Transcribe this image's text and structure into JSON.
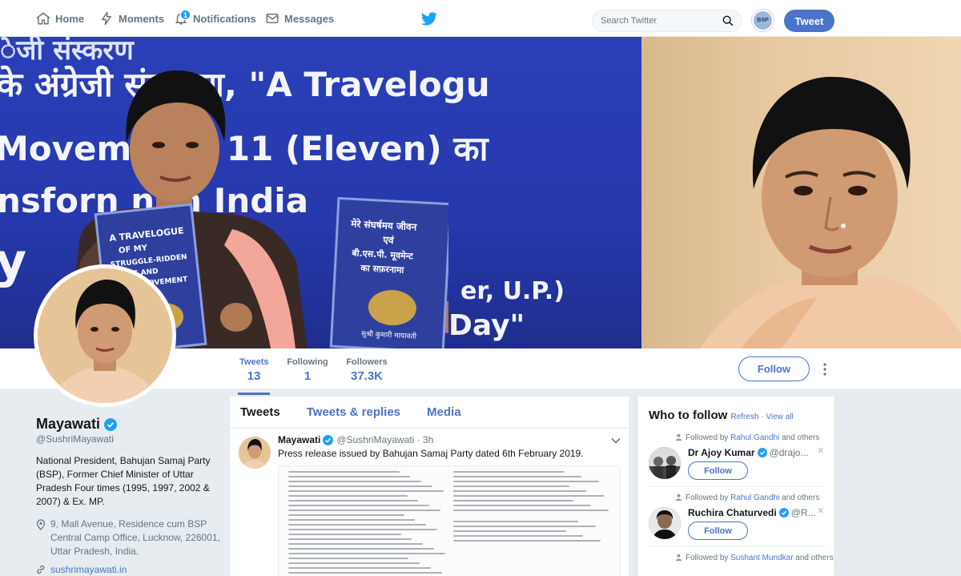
{
  "nav": {
    "home": "Home",
    "moments": "Moments",
    "notifications": "Notifications",
    "notification_count": "1",
    "messages": "Messages",
    "search_placeholder": "Search Twitter",
    "avatar_text": "BSP",
    "tweet_button": "Tweet"
  },
  "banner": {
    "line1": "ेजी संस्करण   ",
    "line2": "के अंग्रेजी संस्करण, \"A Travelogu",
    "line3": "Movem    Vol. 11 (Eleven) का",
    "line4": "nsforn    n in India",
    "line5": "y",
    "line6": "er, U.P.)",
    "line7": "Day\"",
    "book1_title": "A TRAVELOGUE OF MY STRUGGLE-RIDDEN LIFE AND B.S.P. MOVEMENT",
    "book2_title": "मेरे संघर्षमय जीवन एवं बी.एस.पी. मूवमेन्ट का सफ़रनामा",
    "book2_author": "सुश्री कुमारी मायावती"
  },
  "stats": [
    {
      "label": "Tweets",
      "value": "13"
    },
    {
      "label": "Following",
      "value": "1"
    },
    {
      "label": "Followers",
      "value": "37.3K"
    }
  ],
  "profile": {
    "follow_button": "Follow",
    "name": "Mayawati",
    "handle": "@SushriMayawati",
    "bio": "National President, Bahujan Samaj Party (BSP), Former Chief Minister of Uttar Pradesh Four times (1995, 1997, 2002 & 2007) & Ex. MP.",
    "location": "9, Mall Avenue, Residence cum BSP Central Camp Office, Lucknow, 226001, Uttar Pradesh, India.",
    "link": "sushrimayawati.in"
  },
  "timeline": {
    "tabs": [
      "Tweets",
      "Tweets & replies",
      "Media"
    ],
    "tweet": {
      "name": "Mayawati",
      "handle_time": "@SushriMayawati · 3h",
      "text": "Press release issued by Bahujan Samaj Party dated 6th February 2019."
    }
  },
  "who_to_follow": {
    "title": "Who to follow",
    "refresh": "Refresh",
    "separator": "·",
    "view_all": "View all",
    "suggestions": [
      {
        "followed_prefix": "Followed by ",
        "followed_name": "Rahul Gandhi",
        "followed_suffix": " and others",
        "name": "Dr Ajoy Kumar",
        "handle": "@drajo...",
        "follow": "Follow",
        "close": "✕"
      },
      {
        "followed_prefix": "Followed by ",
        "followed_name": "Rahul Gandhi",
        "followed_suffix": " and others",
        "name": "Ruchira Chaturvedi",
        "handle": "@R...",
        "follow": "Follow",
        "close": "✕"
      },
      {
        "followed_prefix": "Followed by ",
        "followed_name": "Sushant Mundkar",
        "followed_suffix": " and others"
      }
    ]
  },
  "colors": {
    "accent": "#4a74c9",
    "twitter_blue": "#1da1f2",
    "verified": "#1da1f2",
    "banner_blue": "#2638ab"
  }
}
